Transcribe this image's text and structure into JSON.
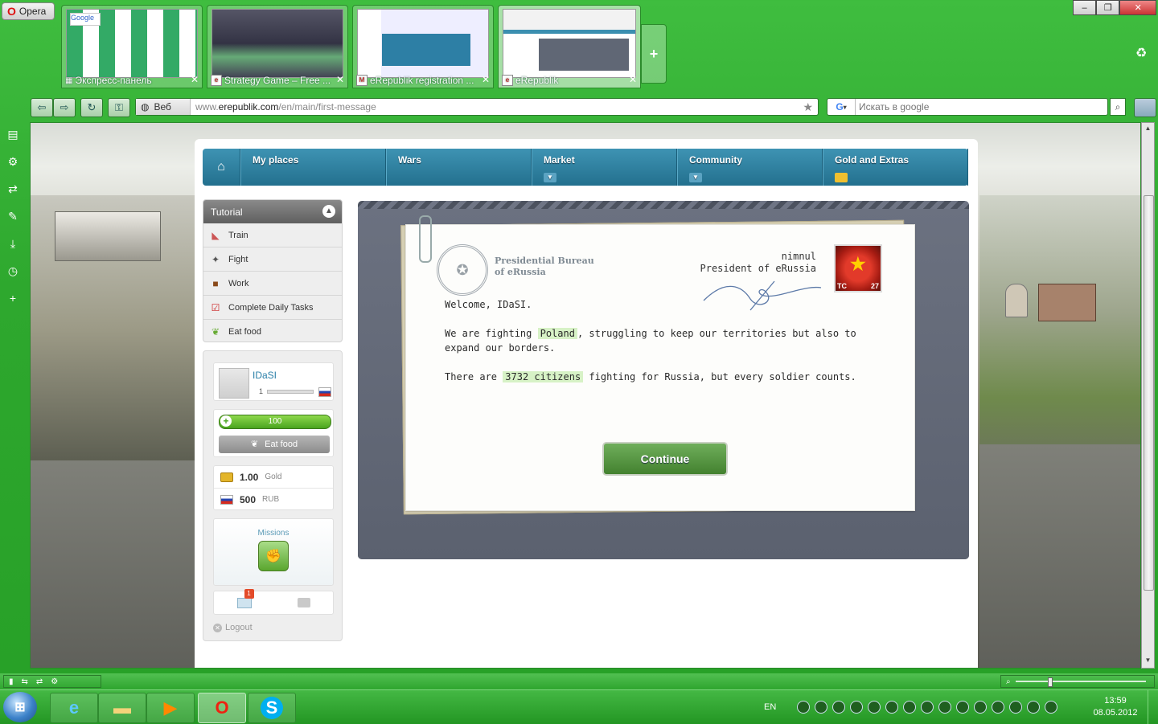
{
  "browser": {
    "menu_label": "Opera",
    "tabs": [
      {
        "title": "Экспресс-панель",
        "active": false
      },
      {
        "title": "Strategy Game – Free ...",
        "active": false
      },
      {
        "title": "eRepublik registration ...",
        "active": false
      },
      {
        "title": "eRepublik",
        "active": true
      }
    ],
    "address": {
      "mode_label": "Веб",
      "url_prefix": "www.",
      "url_host": "erepublik.com",
      "url_path": "/en/main/first-message"
    },
    "search": {
      "engine": "G",
      "placeholder": "Искать в google"
    }
  },
  "site": {
    "nav": {
      "items": [
        "My places",
        "Wars",
        "Market",
        "Community",
        "Gold and Extras"
      ]
    },
    "tutorial": {
      "title": "Tutorial",
      "items": [
        {
          "label": "Train",
          "icon": "train-icon"
        },
        {
          "label": "Fight",
          "icon": "gun-icon"
        },
        {
          "label": "Work",
          "icon": "briefcase-icon"
        },
        {
          "label": "Complete Daily Tasks",
          "icon": "checklist-icon"
        },
        {
          "label": "Eat food",
          "icon": "food-icon"
        }
      ]
    },
    "profile": {
      "username": "IDaSI",
      "level": "1",
      "health": "100",
      "eat_food_label": "Eat food",
      "gold_amount": "1.00",
      "gold_unit": "Gold",
      "currency_amount": "500",
      "currency_unit": "RUB",
      "missions_label": "Missions",
      "messages_badge": "1",
      "logout_label": "Logout"
    },
    "letter": {
      "bureau_line1": "Presidential Bureau",
      "bureau_line2": "of eRussia",
      "president_name": "nimnul",
      "president_title": "President of eRussia",
      "avatar_left": "TC",
      "avatar_right": "27",
      "greeting": "Welcome, IDaSI.",
      "p1_before": "We are fighting",
      "p1_country": "Poland",
      "p1_after": ", struggling to keep our territories but also to expand our borders.",
      "p2_before": "There are",
      "p2_citizens": "3732 citizens",
      "p2_after": "fighting for Russia, but every soldier counts.",
      "continue_label": "Continue"
    }
  },
  "taskbar": {
    "language": "EN",
    "time": "13:59",
    "date": "08.05.2012"
  }
}
